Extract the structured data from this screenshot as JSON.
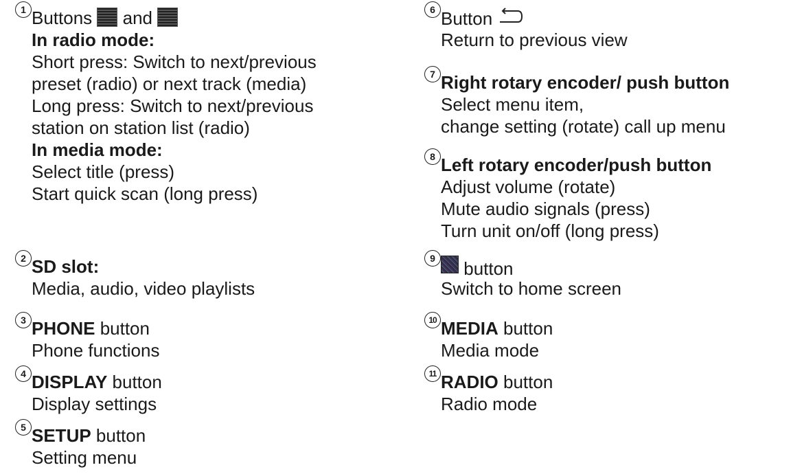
{
  "left": {
    "i1": {
      "num": "1",
      "l1a": "Buttons",
      "l1b": "and",
      "h1": "In radio mode:",
      "r1": "Short press: Switch to next/previous",
      "r2": "preset (radio) or next track (media)",
      "r3": "Long press: Switch to next/previous",
      "r4": "station on station list (radio)",
      "h2": "In media mode:",
      "m1": "Select title (press)",
      "m2": "Start quick scan (long press)"
    },
    "i2": {
      "num": "2",
      "title": "SD slot:",
      "desc": "Media, audio, video playlists"
    },
    "i3": {
      "num": "3",
      "bold": "PHONE",
      "rest": " button",
      "desc": "Phone functions"
    },
    "i4": {
      "num": "4",
      "bold": "DISPLAY",
      "rest": " button",
      "desc": "Display settings"
    },
    "i5": {
      "num": "5",
      "bold": "SETUP",
      "rest": " button",
      "desc": "Setting menu"
    }
  },
  "right": {
    "i6": {
      "num": "6",
      "label": "Button",
      "desc": "Return to previous view"
    },
    "i7": {
      "num": "7",
      "title": "Right rotary encoder/ push button",
      "d1": "Select menu item,",
      "d2": "change setting (rotate) call up menu"
    },
    "i8": {
      "num": "8",
      "title": "Left rotary encoder/push button",
      "d1": "Adjust volume (rotate)",
      "d2": "Mute audio signals (press)",
      "d3": "Turn unit on/off (long press)"
    },
    "i9": {
      "num": "9",
      "label": "button",
      "desc": "Switch to home screen"
    },
    "i10": {
      "num": "10",
      "bold": "MEDIA",
      "rest": " button",
      "desc": "Media mode"
    },
    "i11": {
      "num": "11",
      "bold": "RADIO",
      "rest": " button",
      "desc": "Radio mode"
    }
  },
  "icons": {
    "prev_next": "seek-button-icon",
    "back": "back-arrow-icon",
    "home": "home-button-icon"
  }
}
